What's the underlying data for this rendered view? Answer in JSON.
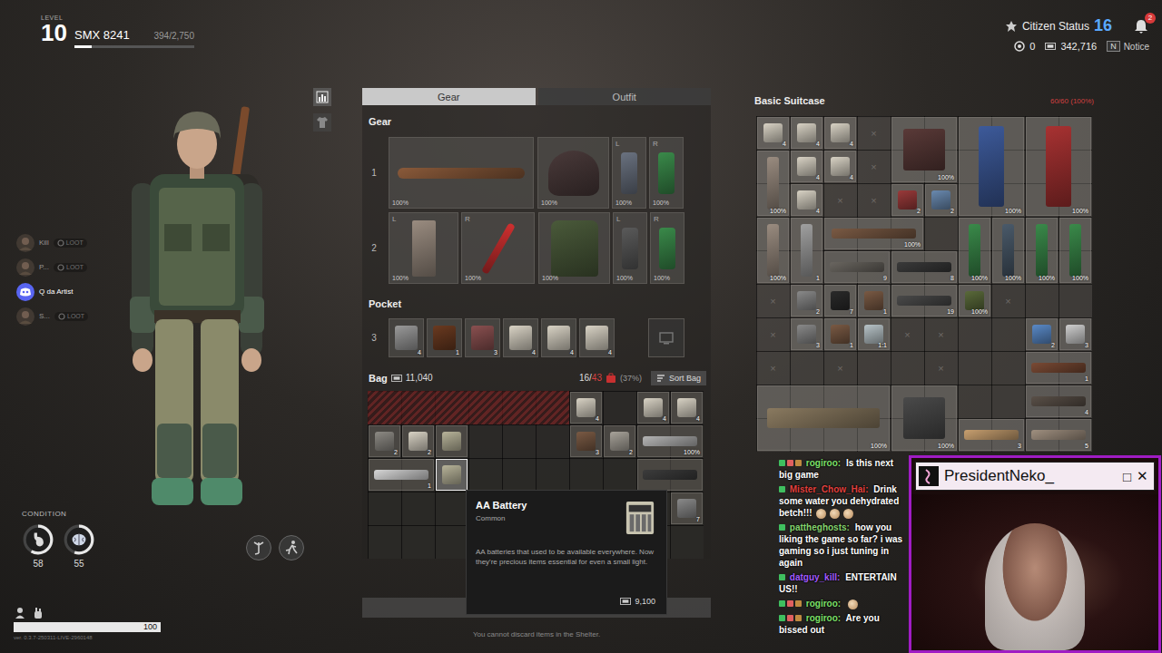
{
  "player": {
    "level_label": "LEVEL",
    "level": "10",
    "name": "SMX 8241",
    "xp": "394/2,750",
    "xp_level": 0.143
  },
  "status": {
    "citizen_label": "Citizen Status",
    "citizen_rank": "16",
    "notifications": "2",
    "coins": "0",
    "cash": "342,716",
    "notice_key": "N",
    "notice_label": "Notice"
  },
  "party": [
    {
      "name": "Kill",
      "tag": "LOOT",
      "discord": false
    },
    {
      "name": "P...",
      "tag": "LOOT",
      "discord": false
    },
    {
      "name": "Q da Artist",
      "discord": true
    },
    {
      "name": "S...",
      "tag": "LOOT",
      "discord": false
    }
  ],
  "condition": {
    "label": "CONDITION",
    "gauges": [
      {
        "kind": "stomach",
        "reading": "58",
        "level": 0.58
      },
      {
        "kind": "brain",
        "reading": "55",
        "level": 0.55
      }
    ]
  },
  "health": {
    "reading": "100",
    "level": 1.0
  },
  "version": "ver. 0.3.7-250311-LIVE-2960148",
  "side_tabs": [
    {
      "kind": "stats",
      "selected": true
    },
    {
      "kind": "outfit",
      "selected": false
    }
  ],
  "tabs": [
    {
      "label": "Gear",
      "selected": true
    },
    {
      "label": "Outfit",
      "selected": false
    }
  ],
  "gear": {
    "label": "Gear",
    "rows": [
      {
        "index": "1",
        "slots": [
          {
            "kind": "weapon",
            "condition": "100%"
          },
          {
            "kind": "head",
            "condition": "100%"
          },
          {
            "kind": "wrap",
            "side": "L",
            "condition": "100%"
          },
          {
            "kind": "wrap",
            "side": "R",
            "condition": "100%"
          }
        ]
      },
      {
        "index": "2",
        "slots": [
          {
            "kind": "plank",
            "side": "L",
            "condition": "100%"
          },
          {
            "kind": "rod",
            "side": "R",
            "condition": "100%"
          },
          {
            "kind": "vest",
            "condition": "100%"
          },
          {
            "kind": "wrap",
            "side": "L",
            "condition": "100%"
          },
          {
            "kind": "wrap",
            "side": "R",
            "condition": "100%"
          }
        ]
      }
    ]
  },
  "pocket": {
    "label": "Pocket",
    "index": "3",
    "slots": [
      {
        "count": "4"
      },
      {
        "count": "1"
      },
      {
        "count": "3"
      },
      {
        "count": "4"
      },
      {
        "count": "4"
      },
      {
        "count": "4"
      }
    ]
  },
  "bag": {
    "label": "Bag",
    "value": "11,040",
    "used": "16",
    "capacity": "43",
    "percent": "(37%)",
    "sort_label": "Sort Bag",
    "items": [
      {
        "kind": "locked"
      },
      {
        "kind": "item",
        "count": "4",
        "hovered": false
      },
      {
        "kind": "item",
        "count": "4",
        "hovered": false
      },
      {
        "kind": "item",
        "count": "4",
        "hovered": false
      },
      {
        "kind": "item",
        "count": "2",
        "hovered": false
      },
      {
        "kind": "item",
        "count": "2",
        "hovered": false
      },
      {
        "kind": "item",
        "hovered": false
      },
      {
        "kind": "item",
        "count": "3",
        "hovered": false
      },
      {
        "kind": "item",
        "count": "2",
        "hovered": false
      },
      {
        "kind": "item",
        "count": "100%",
        "hovered": false
      },
      {
        "kind": "item",
        "count": "1",
        "hovered": false
      },
      {
        "kind": "item",
        "hovered": true
      },
      {
        "kind": "item",
        "hovered": false
      },
      {
        "kind": "item",
        "count": "7",
        "hovered": false
      }
    ]
  },
  "tooltip": {
    "title": "AA Battery",
    "rarity": "Common",
    "description": "AA batteries that used to be available everywhere. Now they're precious items essential for even a small light.",
    "price": "9,100"
  },
  "footer": {
    "hint": "You cannot discard items in the Shelter."
  },
  "suitcase": {
    "title": "Basic Suitcase",
    "capacity": "60/60",
    "percent": "(100%)",
    "items": [
      {
        "kind": "item",
        "count": "4"
      },
      {
        "kind": "item",
        "count": "4"
      },
      {
        "kind": "item",
        "count": "4"
      },
      {
        "kind": "empty",
        "mark": "×"
      },
      {
        "kind": "item",
        "count": "100%"
      },
      {
        "kind": "item",
        "count": "100%"
      },
      {
        "kind": "item",
        "count": "100%"
      },
      {
        "kind": "item",
        "count": "4"
      },
      {
        "kind": "item",
        "count": "4"
      },
      {
        "kind": "empty",
        "mark": "×"
      },
      {
        "kind": "item",
        "count": "100%"
      },
      {
        "kind": "item",
        "count": "4"
      },
      {
        "kind": "empty",
        "mark": "×"
      },
      {
        "kind": "empty",
        "mark": "×"
      },
      {
        "kind": "item",
        "count": "2"
      },
      {
        "kind": "item",
        "count": "2"
      },
      {
        "kind": "item",
        "count": "100%"
      },
      {
        "kind": "item",
        "count": "1"
      },
      {
        "kind": "item",
        "count": "100%"
      },
      {
        "kind": "item",
        "count": "100%"
      },
      {
        "kind": "item",
        "count": "100%"
      },
      {
        "kind": "item",
        "count": "100%"
      },
      {
        "kind": "item",
        "count": "100%"
      },
      {
        "kind": "item",
        "count": "9"
      },
      {
        "kind": "item",
        "count": "8"
      },
      {
        "kind": "empty",
        "mark": "×"
      },
      {
        "kind": "item",
        "count": "2"
      },
      {
        "kind": "item",
        "count": "7"
      },
      {
        "kind": "item",
        "count": "1"
      },
      {
        "kind": "item",
        "count": "19"
      },
      {
        "kind": "item",
        "count": "100%"
      },
      {
        "kind": "empty",
        "mark": "×"
      },
      {
        "kind": "empty",
        "mark": "×"
      },
      {
        "kind": "item",
        "count": "3"
      },
      {
        "kind": "item",
        "count": "1"
      },
      {
        "kind": "item",
        "count": "1:1"
      },
      {
        "kind": "empty",
        "mark": "×"
      },
      {
        "kind": "empty",
        "mark": "×"
      },
      {
        "kind": "item",
        "count": "2"
      },
      {
        "kind": "item",
        "count": "3"
      },
      {
        "kind": "empty",
        "mark": "×"
      },
      {
        "kind": "empty",
        "mark": "×"
      },
      {
        "kind": "empty",
        "mark": "×"
      },
      {
        "kind": "item",
        "count": "1"
      },
      {
        "kind": "item",
        "count": "100%"
      },
      {
        "kind": "item",
        "count": "100%"
      },
      {
        "kind": "item",
        "count": "4"
      },
      {
        "kind": "item",
        "count": "3"
      },
      {
        "kind": "item",
        "count": "5"
      }
    ]
  },
  "chat": [
    {
      "user": "rogiroo:",
      "color": "#7ee06a",
      "badges": 3,
      "emotes": 0,
      "text": "Is this next big game"
    },
    {
      "user": "Mister_Chow_Hai:",
      "color": "#e0413f",
      "badges": 1,
      "emotes": 3,
      "text": "Drink some water you dehydrated betch!!!"
    },
    {
      "user": "pattheghosts:",
      "color": "#86d46f",
      "badges": 1,
      "emotes": 0,
      "text": "how you liking the game so far? i was gaming so i just tuning in again"
    },
    {
      "user": "datguy_kill:",
      "color": "#a35bff",
      "badges": 1,
      "emotes": 0,
      "text": "ENTERTAIN US!!"
    },
    {
      "user": "rogiroo:",
      "color": "#7ee06a",
      "badges": 3,
      "emotes": 1
    },
    {
      "user": "rogiroo:",
      "color": "#7ee06a",
      "badges": 3,
      "emotes": 0,
      "text": "Are you bissed out"
    }
  ],
  "webcam": {
    "title": "PresidentNeko_",
    "buttons": [
      "□",
      "✕"
    ]
  }
}
